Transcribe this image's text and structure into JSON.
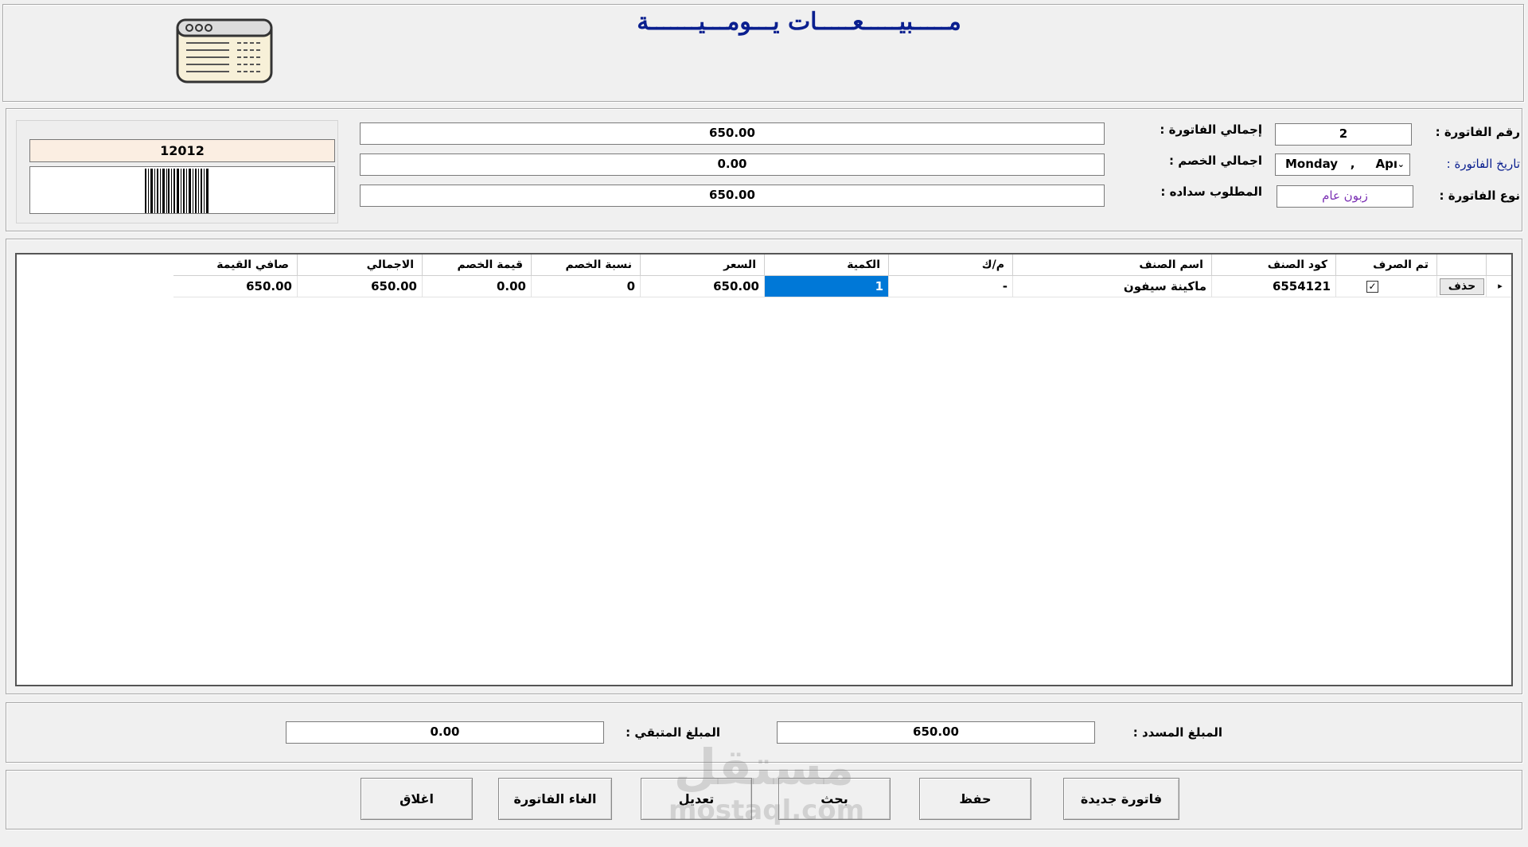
{
  "header": {
    "title": "مـــــبيـــــعـــــات يـــومـــيـــــــة"
  },
  "invoice": {
    "number_label": "رقم الفاتورة :",
    "number_value": "2",
    "date_label": "تاريخ الفاتورة :",
    "date_value": "Monday   ,     Apı",
    "type_label": "نوع الفاتورة :",
    "type_value": "زبون عام",
    "total_label": "إجمالي الفاتورة :",
    "total_value": "650.00",
    "discount_label": "اجمالي الخصم :",
    "discount_value": "0.00",
    "due_label": "المطلوب سداده :",
    "due_value": "650.00",
    "barcode_number": "12012"
  },
  "grid": {
    "columns": [
      "",
      "تم الصرف",
      "كود الصنف",
      "اسم الصنف",
      "م/ك",
      "الكمية",
      "السعر",
      "نسبة الخصم",
      "قيمة الخصم",
      "الاجمالي",
      "صافي القيمة"
    ],
    "rows": [
      {
        "delete_label": "حذف",
        "dispensed": true,
        "code": "6554121",
        "name": "ماكينة سيفون",
        "unit": "-",
        "quantity": "1",
        "price": "650.00",
        "discount_pct": "0",
        "discount_value": "0.00",
        "total": "650.00",
        "net": "650.00"
      }
    ]
  },
  "totals": {
    "paid_label": "المبلغ المسدد :",
    "paid_value": "650.00",
    "remaining_label": "المبلغ المتبقي :",
    "remaining_value": "0.00"
  },
  "buttons": {
    "new_invoice": "فاتورة جديدة",
    "save": "حفظ",
    "search": "بحث",
    "edit": "تعديل",
    "cancel_invoice": "الغاء الفاتورة",
    "close": "اغلاق"
  },
  "watermark": {
    "arabic": "مستقل",
    "latin": "mostaql.com"
  },
  "colors": {
    "title": "#0a1f8f",
    "selected_cell": "#0078d7",
    "label_blue": "#0a1f8f",
    "type_text": "#7a2fb3",
    "barcode_bg": "#fbeee2"
  }
}
